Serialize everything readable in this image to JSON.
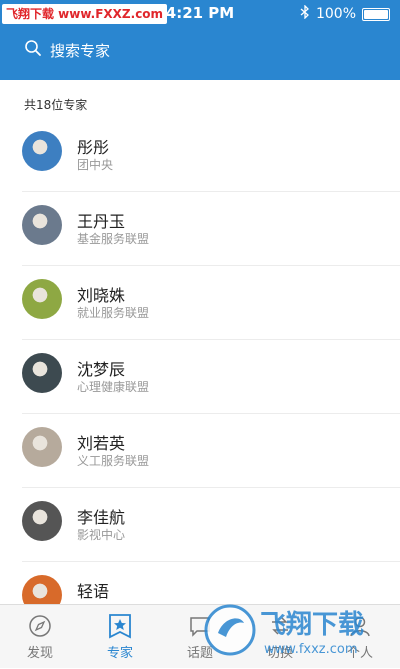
{
  "status_bar": {
    "watermark": "飞翔下载 www.FXXZ.com",
    "time": "4:21 PM",
    "battery": "100%"
  },
  "search": {
    "placeholder": "搜索专家"
  },
  "list_count": "共18位专家",
  "experts": [
    {
      "name": "彤彤",
      "org": "团中央",
      "avatar_color": "#3d7fc1"
    },
    {
      "name": "王丹玉",
      "org": "基金服务联盟",
      "avatar_color": "#6b7a8d"
    },
    {
      "name": "刘晓姝",
      "org": "就业服务联盟",
      "avatar_color": "#8ea843"
    },
    {
      "name": "沈梦辰",
      "org": "心理健康联盟",
      "avatar_color": "#3d4a50"
    },
    {
      "name": "刘若英",
      "org": "义工服务联盟",
      "avatar_color": "#b6aa9c"
    },
    {
      "name": "李佳航",
      "org": "影视中心",
      "avatar_color": "#555555"
    },
    {
      "name": "轻语",
      "org": "",
      "avatar_color": "#d86a2a"
    }
  ],
  "tabbar": [
    {
      "label": "发现",
      "icon": "compass-icon",
      "active": false
    },
    {
      "label": "专家",
      "icon": "star-badge-icon",
      "active": true
    },
    {
      "label": "话题",
      "icon": "chat-icon",
      "active": false
    },
    {
      "label": "切换",
      "icon": "switch-icon",
      "active": false
    },
    {
      "label": "个人",
      "icon": "person-icon",
      "active": false
    }
  ],
  "watermark_logo": {
    "title": "飞翔下载",
    "url": "www.fxxz.com"
  },
  "colors": {
    "primary": "#2a86d0"
  }
}
